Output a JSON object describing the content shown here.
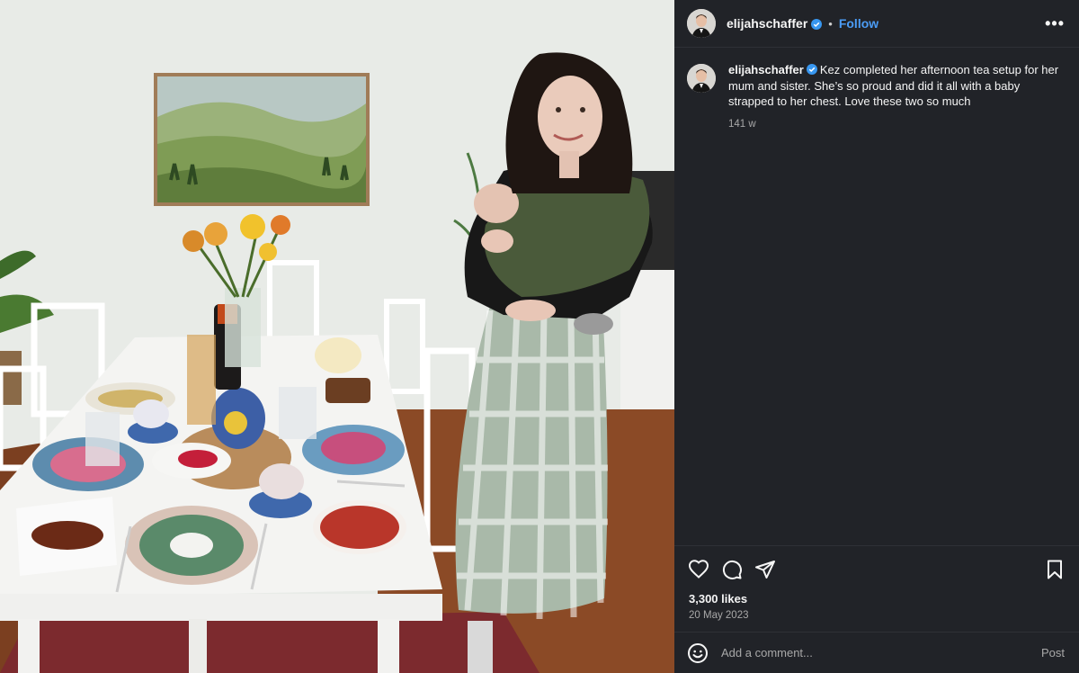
{
  "photo": {
    "alt_icon": "photo-image",
    "colors": {
      "wall": "#eceeea",
      "table": "#f4f4f2",
      "floor": "#8b4a26",
      "skirt": "#a9b9a9",
      "sling": "#4a5a3a"
    }
  },
  "header": {
    "avatar_icon": "avatar-icon",
    "username": "elijahschaffer",
    "verified_icon": "verified-badge-icon",
    "separator": "•",
    "follow_label": "Follow",
    "more_label": "•••"
  },
  "caption": {
    "username": "elijahschaffer",
    "text": "Kez completed her afternoon tea setup for her mum and sister. She’s so proud and did it all with a baby strapped to her chest. Love these two so much",
    "age": "141 w"
  },
  "actions": {
    "like_icon": "heart-icon",
    "comment_icon": "comment-icon",
    "share_icon": "share-icon",
    "save_icon": "bookmark-icon"
  },
  "stats": {
    "likes": "3,300 likes",
    "date": "20 May 2023"
  },
  "comment_box": {
    "emoji_icon": "emoji-icon",
    "placeholder": "Add a comment...",
    "post_label": "Post"
  },
  "colors": {
    "panel_bg": "#212328",
    "accent": "#4b9cf5",
    "verified": "#3897f0",
    "muted": "#a8a8a8"
  }
}
